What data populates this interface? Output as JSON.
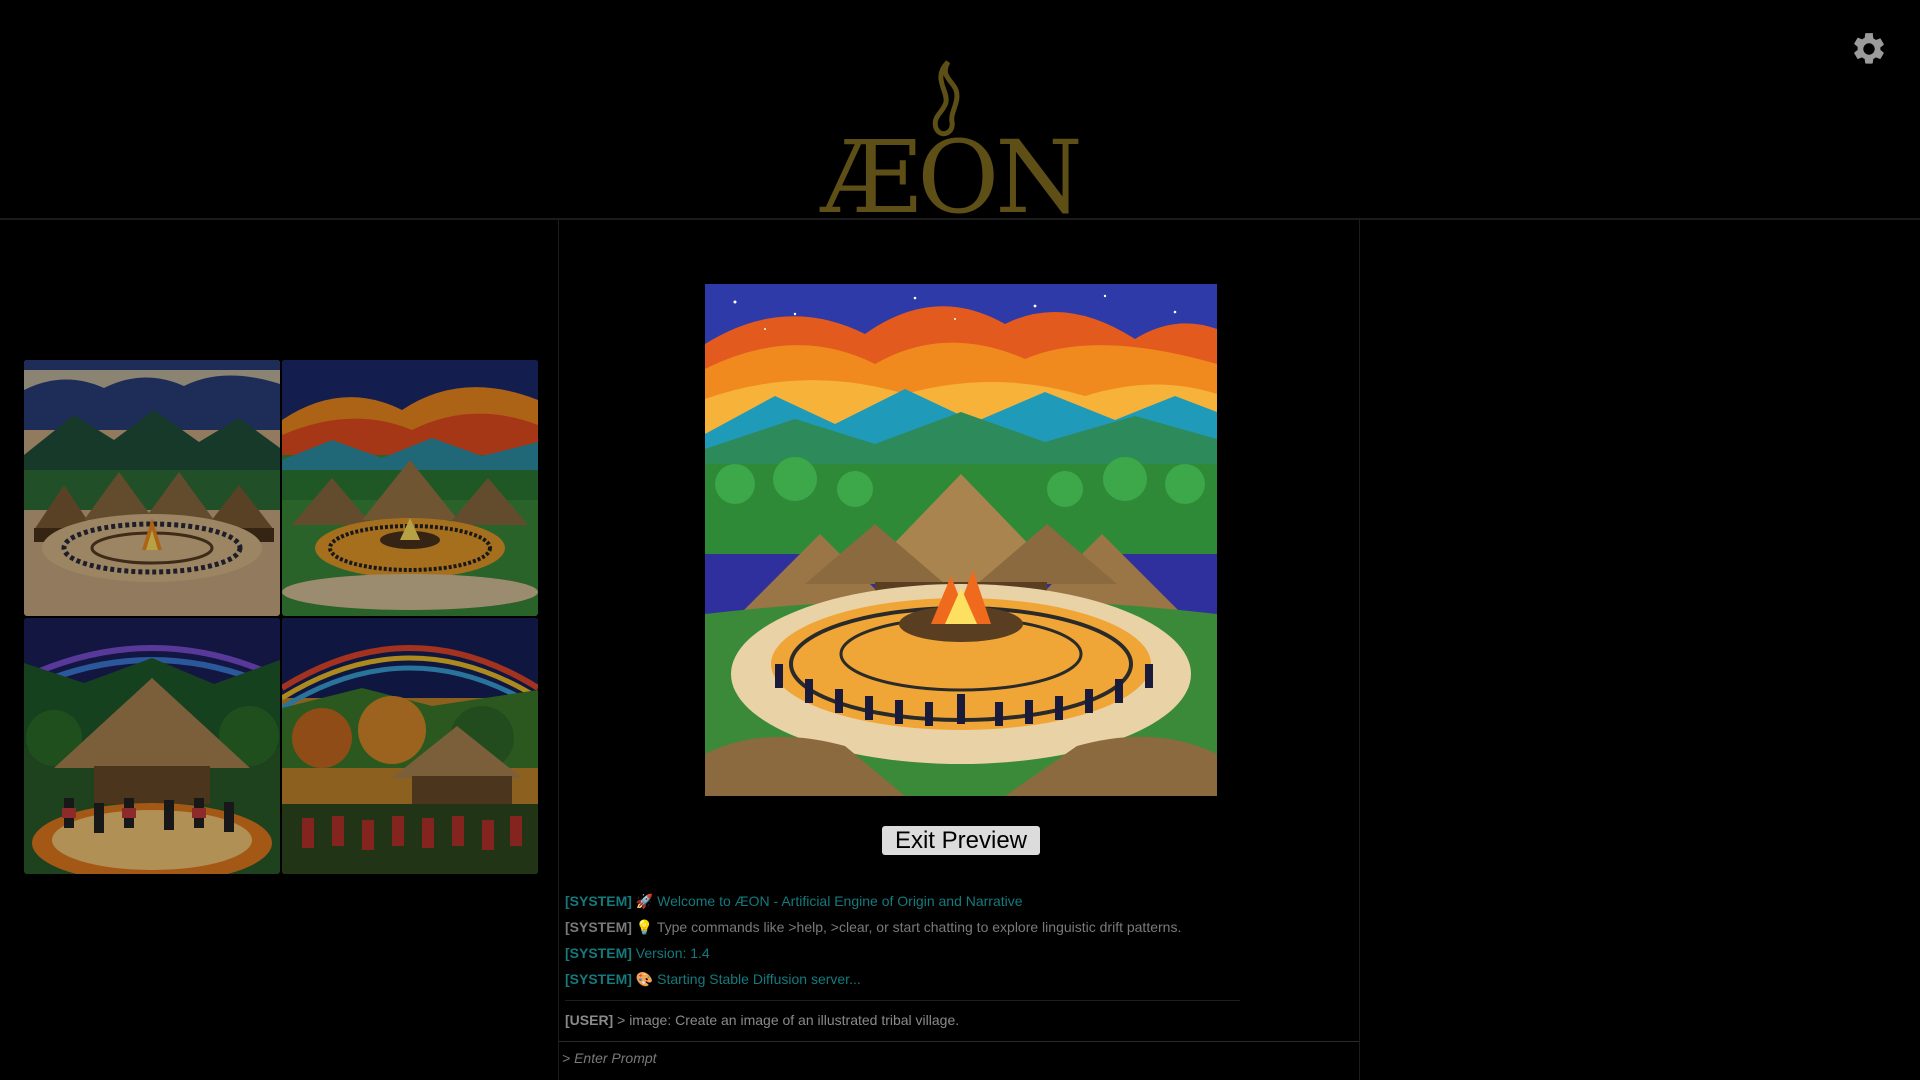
{
  "app": {
    "logo_text": "ÆON",
    "brand_color": "#6b5a1a"
  },
  "header": {
    "settings_icon": "gear-icon"
  },
  "gallery": {
    "thumbnails": [
      {
        "name": "thumbnail-1"
      },
      {
        "name": "thumbnail-2"
      },
      {
        "name": "thumbnail-3"
      },
      {
        "name": "thumbnail-4"
      }
    ]
  },
  "preview": {
    "exit_label": "Exit Preview"
  },
  "console": {
    "messages": [
      {
        "tag": "[SYSTEM]",
        "icon": "🚀",
        "text": "Welcome to ÆON - Artificial Engine of Origin and Narrative",
        "color": "#147a7e"
      },
      {
        "tag": "[SYSTEM]",
        "icon": "💡",
        "text": "Type commands like >help, >clear, or start chatting to explore linguistic drift patterns.",
        "color": "#7a7a7a"
      },
      {
        "tag": "[SYSTEM]",
        "icon": "",
        "text": "Version: 1.4",
        "color": "#147a7e"
      },
      {
        "tag": "[SYSTEM]",
        "icon": "🎨",
        "text": "Starting Stable Diffusion server...",
        "color": "#147a7e"
      }
    ],
    "user_message": {
      "tag": "[USER]",
      "text": "> image: Create an image of an illustrated tribal village."
    },
    "prompt_placeholder": "> Enter Prompt"
  }
}
